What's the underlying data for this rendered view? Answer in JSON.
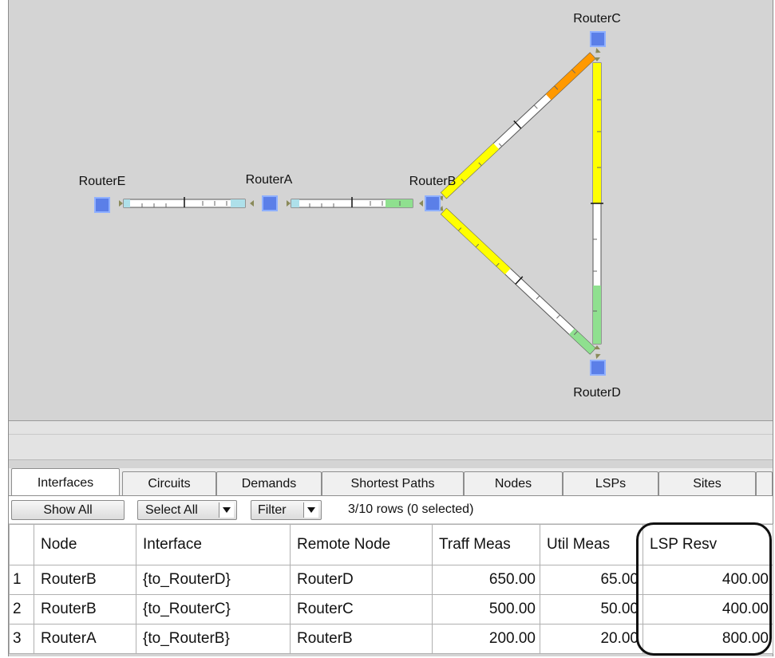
{
  "map": {
    "nodes": [
      {
        "id": "routere",
        "label": "RouterE"
      },
      {
        "id": "routera",
        "label": "RouterA"
      },
      {
        "id": "routerb",
        "label": "RouterB"
      },
      {
        "id": "routerc",
        "label": "RouterC"
      },
      {
        "id": "routerd",
        "label": "RouterD"
      }
    ],
    "links": [
      {
        "from": "RouterE",
        "to": "RouterA",
        "util_fill": "light-blue",
        "color": "#aee0ea"
      },
      {
        "from": "RouterA",
        "to": "RouterB",
        "util_fill": "green",
        "color": "#8fe08f"
      },
      {
        "from": "RouterB",
        "to": "RouterC",
        "util_fill": "yellow / orange",
        "colors": [
          "#ffff00",
          "#ff9900"
        ]
      },
      {
        "from": "RouterB",
        "to": "RouterD",
        "util_fill": "yellow / green",
        "colors": [
          "#ffff00",
          "#8fe08f"
        ]
      },
      {
        "from": "RouterC",
        "to": "RouterD",
        "util_fill": "yellow / green",
        "colors": [
          "#ffff00",
          "#8fe08f"
        ]
      }
    ],
    "node_color": "#5b7fe8"
  },
  "tabs": [
    "Interfaces",
    "Circuits",
    "Demands",
    "Shortest Paths",
    "Nodes",
    "LSPs",
    "Sites"
  ],
  "active_tab": "Interfaces",
  "toolbar": {
    "show_all": "Show All",
    "select_all": "Select All",
    "filter": "Filter",
    "row_count": "3/10 rows (0 selected)"
  },
  "table": {
    "columns": [
      "Node",
      "Interface",
      "Remote Node",
      "Traff Meas",
      "Util Meas",
      "LSP Resv"
    ],
    "rows": [
      {
        "index": "1",
        "node": "RouterB",
        "interface": "{to_RouterD}",
        "remote_node": "RouterD",
        "traff_meas": "650.00",
        "util_meas": "65.00",
        "lsp_resv": "400.00"
      },
      {
        "index": "2",
        "node": "RouterB",
        "interface": "{to_RouterC}",
        "remote_node": "RouterC",
        "traff_meas": "500.00",
        "util_meas": "50.00",
        "lsp_resv": "400.00"
      },
      {
        "index": "3",
        "node": "RouterA",
        "interface": "{to_RouterB}",
        "remote_node": "RouterB",
        "traff_meas": "200.00",
        "util_meas": "20.00",
        "lsp_resv": "800.00"
      }
    ]
  }
}
